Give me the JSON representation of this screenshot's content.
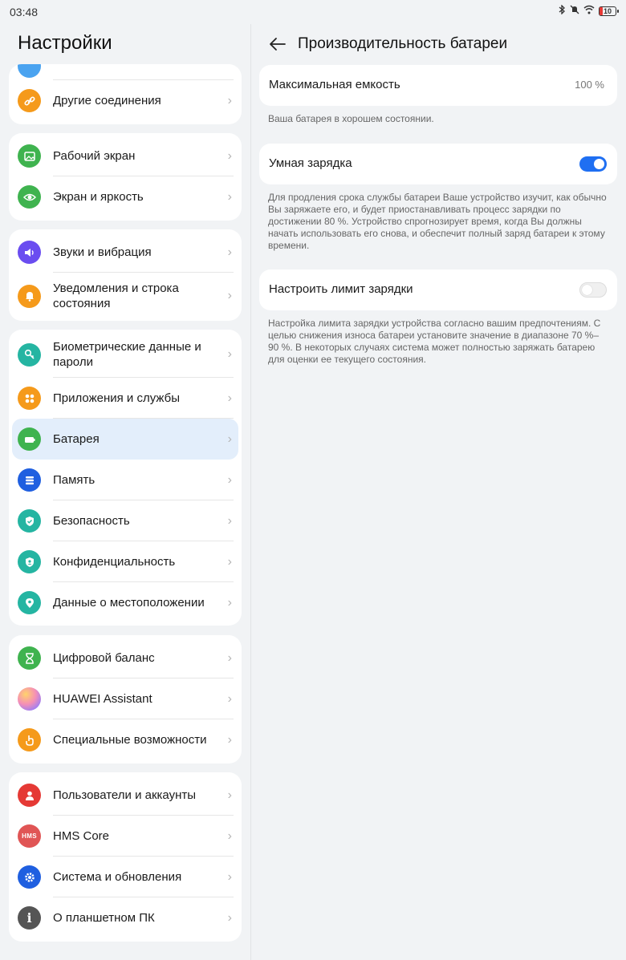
{
  "status_bar": {
    "time": "03:48",
    "battery_level": "10"
  },
  "left": {
    "title": "Настройки",
    "groups": [
      {
        "items": [
          {
            "label": "",
            "icon": "partial-icon",
            "color": "#4aa3f0"
          },
          {
            "label": "Другие соединения",
            "icon": "link-icon",
            "color": "#f59a1b"
          }
        ]
      },
      {
        "items": [
          {
            "label": "Рабочий экран",
            "icon": "image-icon",
            "color": "#3fb34f"
          },
          {
            "label": "Экран и яркость",
            "icon": "eye-icon",
            "color": "#3fb34f"
          }
        ]
      },
      {
        "items": [
          {
            "label": "Звуки и вибрация",
            "icon": "speaker-icon",
            "color": "#6a4df0"
          },
          {
            "label": "Уведомления и строка состояния",
            "icon": "bell-icon",
            "color": "#f59a1b"
          }
        ]
      },
      {
        "items": [
          {
            "label": "Биометрические данные и пароли",
            "icon": "key-icon",
            "color": "#25b5a2"
          },
          {
            "label": "Приложения и службы",
            "icon": "apps-icon",
            "color": "#f59a1b"
          },
          {
            "label": "Батарея",
            "icon": "battery-icon",
            "color": "#3fb34f"
          },
          {
            "label": "Память",
            "icon": "storage-icon",
            "color": "#1f5fe0"
          },
          {
            "label": "Безопасность",
            "icon": "shield-icon",
            "color": "#25b5a2"
          },
          {
            "label": "Конфиденциальность",
            "icon": "privacy-icon",
            "color": "#25b5a2"
          },
          {
            "label": "Данные о местоположении",
            "icon": "location-icon",
            "color": "#25b5a2"
          }
        ]
      },
      {
        "items": [
          {
            "label": "Цифровой баланс",
            "icon": "hourglass-icon",
            "color": "#3fb34f"
          },
          {
            "label": "HUAWEI Assistant",
            "icon": "assistant-icon",
            "color": "#c88cf0"
          },
          {
            "label": "Специальные возможности",
            "icon": "hand-icon",
            "color": "#f59a1b"
          }
        ]
      },
      {
        "items": [
          {
            "label": "Пользователи и аккаунты",
            "icon": "user-icon",
            "color": "#e53935"
          },
          {
            "label": "HMS Core",
            "icon": "hms-icon",
            "color": "#e05555",
            "icon_text": "HMS"
          },
          {
            "label": "Система и обновления",
            "icon": "gear-icon",
            "color": "#1f5fe0"
          },
          {
            "label": "О планшетном ПК",
            "icon": "info-icon",
            "color": "#555555",
            "icon_text": "i"
          }
        ]
      }
    ]
  },
  "right": {
    "title": "Производительность батареи",
    "max_capacity": {
      "title": "Максимальная емкость",
      "value": "100 %"
    },
    "max_capacity_desc": "Ваша батарея в хорошем состоянии.",
    "smart_charging": {
      "title": "Умная зарядка",
      "enabled": true
    },
    "smart_charging_desc": "Для продления срока службы батареи Ваше устройство изучит, как обычно Вы заряжаете его, и будет приостанавливать процесс зарядки по достижении 80 %. Устройство спрогнозирует время, когда Вы должны начать использовать его снова, и обеспечит полный заряд батареи к этому времени.",
    "charge_limit": {
      "title": "Настроить лимит зарядки",
      "enabled": false
    },
    "charge_limit_desc": "Настройка лимита зарядки устройства согласно вашим предпочтениям. С целью снижения износа батареи установите значение в диапазоне 70 %–90 %. В некоторых случаях система может полностью заряжать батарею для оценки ее текущего состояния."
  }
}
